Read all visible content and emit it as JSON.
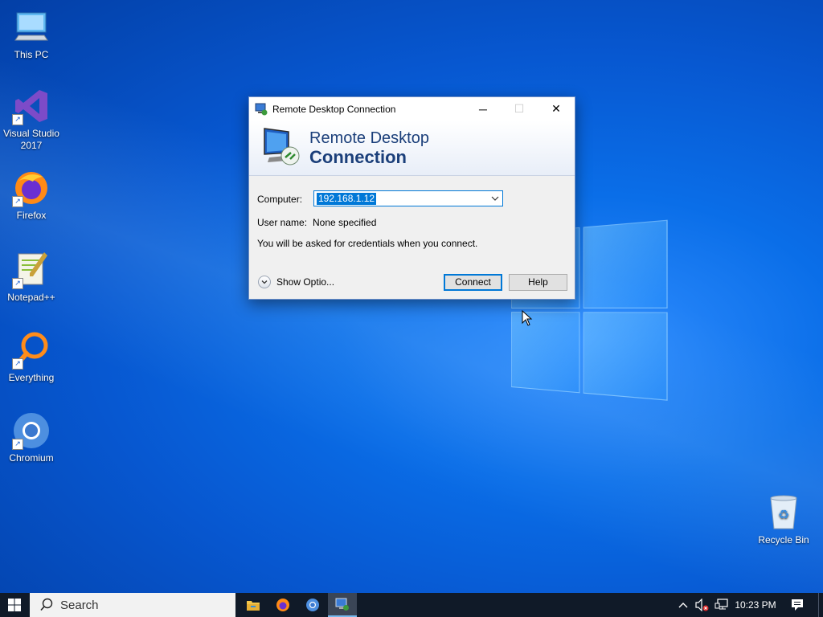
{
  "desktop": {
    "icons": [
      {
        "label": "This PC",
        "icon": "computer-icon"
      },
      {
        "label": "Visual Studio 2017",
        "icon": "visual-studio-icon"
      },
      {
        "label": "Firefox",
        "icon": "firefox-icon"
      },
      {
        "label": "Notepad++",
        "icon": "notepad-plus-plus-icon"
      },
      {
        "label": "Everything",
        "icon": "everything-search-icon"
      },
      {
        "label": "Chromium",
        "icon": "chromium-icon"
      },
      {
        "label": "Recycle Bin",
        "icon": "recycle-bin-icon"
      }
    ]
  },
  "dialog": {
    "title": "Remote Desktop Connection",
    "banner_line1": "Remote Desktop",
    "banner_line2": "Connection",
    "computer_label": "Computer:",
    "computer_value": "192.168.1.12",
    "username_label": "User name:",
    "username_value": "None specified",
    "info_text": "You will be asked for credentials when you connect.",
    "show_options_label": "Show Optio...",
    "connect_label": "Connect",
    "help_label": "Help",
    "controls": {
      "minimize": "─",
      "maximize": "☐",
      "close": "✕"
    }
  },
  "taskbar": {
    "search_placeholder": "Search",
    "pinned_apps": [
      "file-explorer-icon",
      "firefox-icon",
      "chromium-icon",
      "remote-desktop-icon"
    ],
    "time": "10:23 PM"
  },
  "colors": {
    "accent": "#0078d7",
    "desktop_blue": "#0a6ee8",
    "taskbar": "#101a28"
  }
}
